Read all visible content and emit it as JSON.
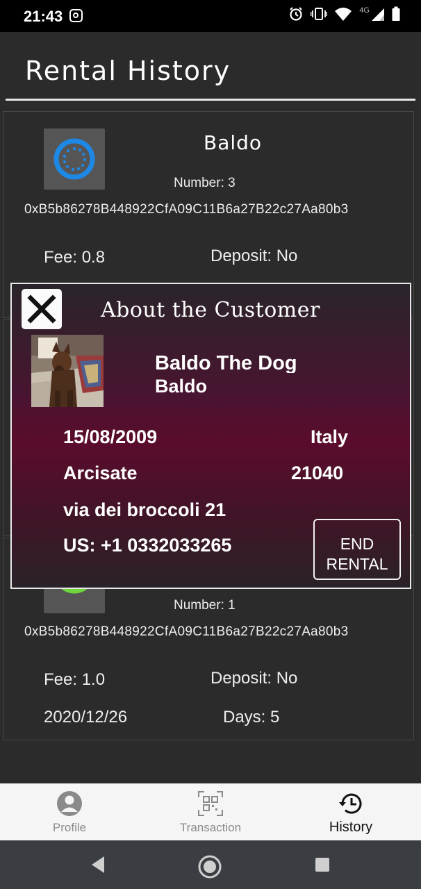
{
  "status_bar": {
    "time": "21:43",
    "network": "4G"
  },
  "header": {
    "title": "Rental History"
  },
  "rentals": [
    {
      "name": "Baldo",
      "number": "Number: 3",
      "address": "0xB5b86278B448922CfA09C11B6a27B22c27Aa80b3",
      "fee": "Fee: 0.8",
      "deposit": "Deposit: No",
      "status_icon": "loading-ring-icon",
      "status_color": "#1e88e5"
    },
    {
      "name": "",
      "number": "Number: 1",
      "address": "0xB5b86278B448922CfA09C11B6a27B22c27Aa80b3",
      "fee": "Fee: 1.0",
      "deposit": "Deposit: No",
      "date": "2020/12/26",
      "days": "Days: 5",
      "status_icon": "check-ring-icon",
      "status_color": "#6fd63c"
    }
  ],
  "modal": {
    "title": "About the Customer",
    "close_icon": "close-icon",
    "customer_name": "Baldo The Dog",
    "username": "Baldo",
    "birth_date": "15/08/2009",
    "country": "Italy",
    "city": "Arcisate",
    "postal_code": "21040",
    "street": "via dei broccoli 21",
    "phone": "US: +1 0332033265",
    "end_button_line1": "END",
    "end_button_line2": "RENTAL"
  },
  "bottom_nav": {
    "items": [
      {
        "label": "Profile",
        "icon": "person-icon",
        "active": false
      },
      {
        "label": "Transaction",
        "icon": "qr-code-icon",
        "active": false
      },
      {
        "label": "History",
        "icon": "history-icon",
        "active": true
      }
    ]
  },
  "colors": {
    "background": "#2b2b2b",
    "modal_accent": "#5b0c2c",
    "nav_background": "#f5f5f5"
  }
}
